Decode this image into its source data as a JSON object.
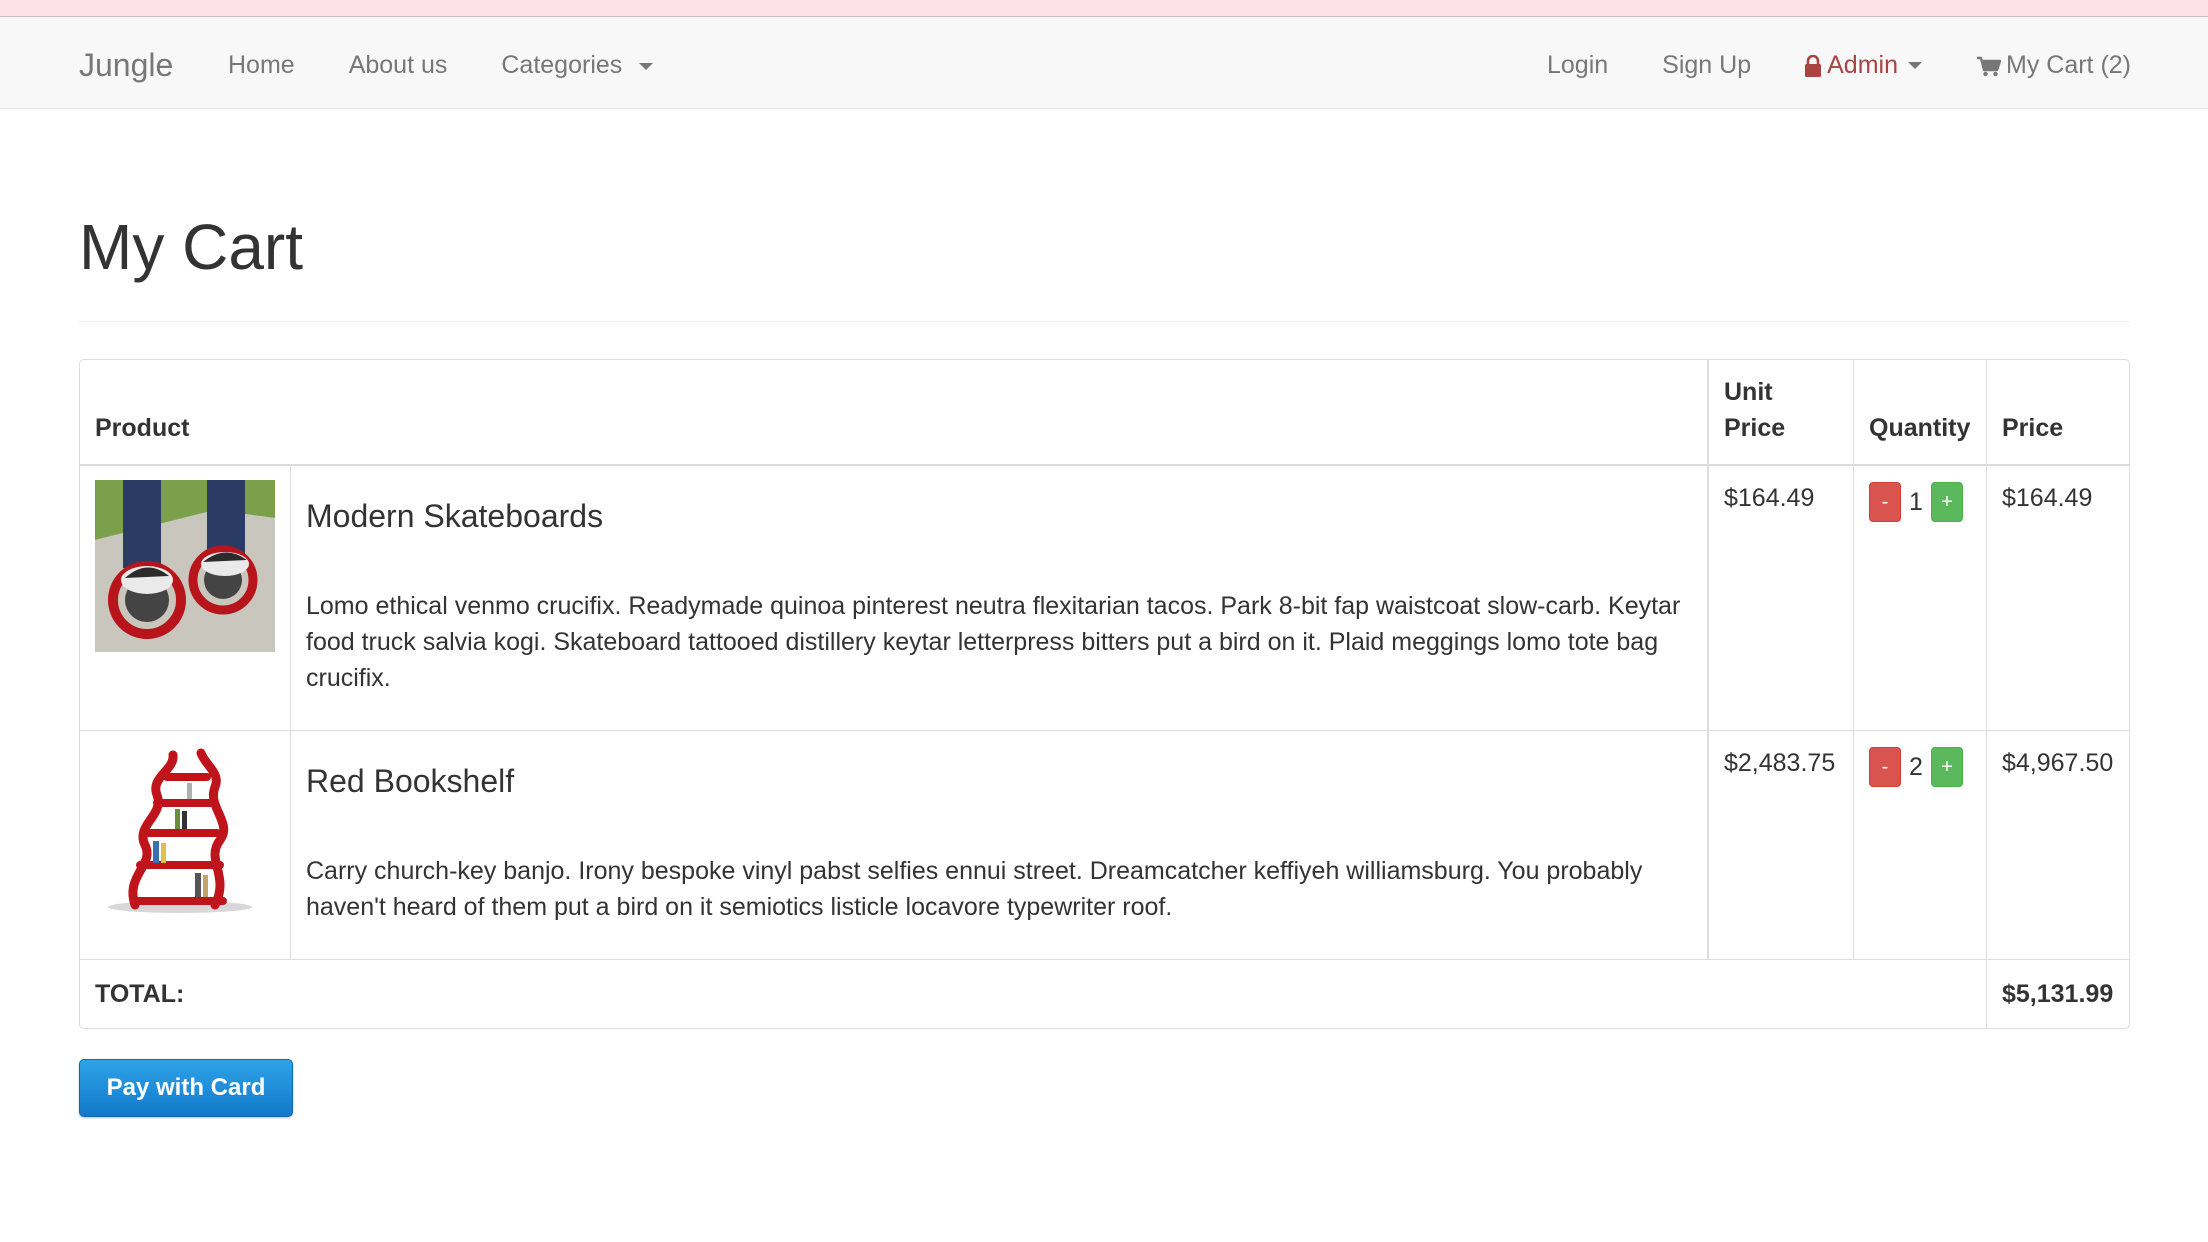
{
  "nav": {
    "brand": "Jungle",
    "home": "Home",
    "about": "About us",
    "categories": "Categories",
    "login": "Login",
    "signup": "Sign Up",
    "admin": "Admin",
    "cart": "My Cart (2)"
  },
  "page": {
    "title": "My Cart"
  },
  "table": {
    "headers": {
      "product": "Product",
      "unit_price_1": "Unit",
      "unit_price_2": "Price",
      "quantity": "Quantity",
      "price": "Price"
    },
    "rows": [
      {
        "name": "Modern Skateboards",
        "description": "Lomo ethical venmo crucifix. Readymade quinoa pinterest neutra flexitarian tacos. Park 8-bit fap waistcoat slow-carb. Keytar food truck salvia kogi. Skateboard tattooed distillery keytar letterpress bitters put a bird on it. Plaid meggings lomo tote bag crucifix.",
        "unit_price": "$164.49",
        "quantity": "1",
        "price": "$164.49",
        "minus": "-",
        "plus": "+"
      },
      {
        "name": "Red Bookshelf",
        "description": "Carry church-key banjo. Irony bespoke vinyl pabst selfies ennui street. Dreamcatcher keffiyeh williamsburg. You probably haven't heard of them put a bird on it semiotics listicle locavore typewriter roof.",
        "unit_price": "$2,483.75",
        "quantity": "2",
        "price": "$4,967.50",
        "minus": "-",
        "plus": "+"
      }
    ],
    "total_label": "TOTAL:",
    "total_value": "$5,131.99"
  },
  "actions": {
    "pay_label": "Pay with Card"
  },
  "colors": {
    "accent_admin": "#a94442",
    "minus_button": "#d9534f",
    "plus_button": "#5cb85c",
    "pay_button": "#1f8ed8"
  },
  "icons": {
    "admin": "lock-icon",
    "cart": "shopping-cart-icon",
    "dropdown": "caret-down-icon"
  }
}
